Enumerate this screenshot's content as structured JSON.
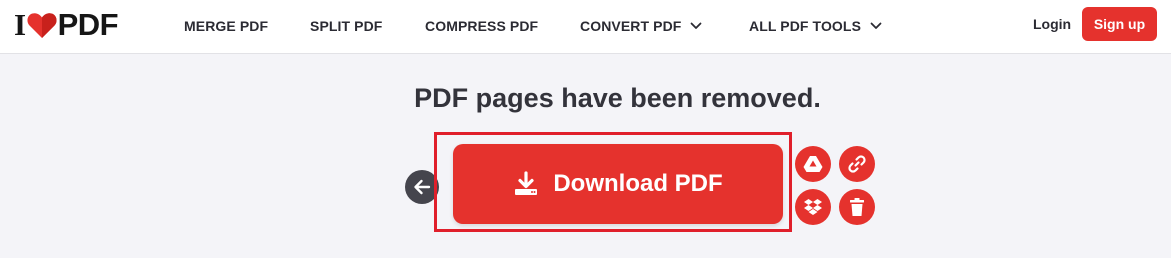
{
  "brand": {
    "logo_left": "I",
    "logo_right": "PDF"
  },
  "nav": [
    {
      "label": "MERGE PDF"
    },
    {
      "label": "SPLIT PDF"
    },
    {
      "label": "COMPRESS PDF"
    },
    {
      "label": "CONVERT PDF",
      "dropdown": true
    },
    {
      "label": "ALL PDF TOOLS",
      "dropdown": true
    }
  ],
  "auth": {
    "login": "Login",
    "signup": "Sign up"
  },
  "result": {
    "headline": "PDF pages have been removed.",
    "download_label": "Download PDF"
  },
  "actions": [
    {
      "icon": "google-drive-icon"
    },
    {
      "icon": "link-icon"
    },
    {
      "icon": "dropbox-icon"
    },
    {
      "icon": "trash-icon"
    }
  ],
  "colors": {
    "brand": "#e5322d",
    "back": "#45454d",
    "highlight": "#e01f2b"
  }
}
